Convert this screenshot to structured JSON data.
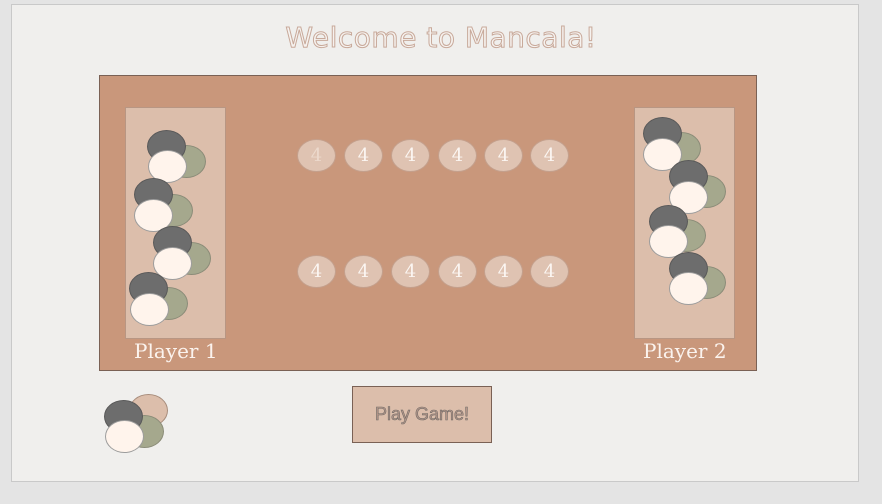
{
  "title": "Welcome to Mancala!",
  "players": {
    "p1_label": "Player 1",
    "p2_label": "Player 2"
  },
  "pits": {
    "top_row": [
      "4",
      "4",
      "4",
      "4",
      "4",
      "4"
    ],
    "bottom_row": [
      "4",
      "4",
      "4",
      "4",
      "4",
      "4"
    ]
  },
  "play_button_label": "Play Game!",
  "colors": {
    "board": "#c9977b",
    "store": "#dcbeab",
    "stone_gray": "#6d6d6d",
    "stone_cream": "#fff4ec",
    "stone_green": "#a5a88d"
  }
}
